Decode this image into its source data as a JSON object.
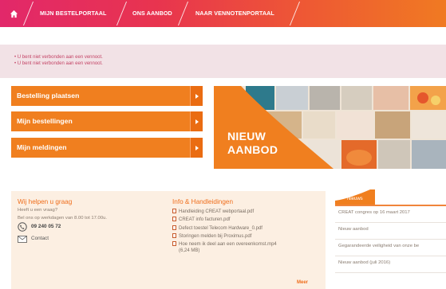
{
  "nav": {
    "items": [
      "MIJN BESTELPORTAAL",
      "ONS AANBOD",
      "NAAR VENNOTENPORTAAL"
    ]
  },
  "messages": [
    "• U bent niet verbonden aan een vennoot.",
    "• U bent niet verbonden aan een vennoot."
  ],
  "menu": [
    {
      "label": "Bestelling plaatsen"
    },
    {
      "label": "Mijn bestellingen"
    },
    {
      "label": "Mijn meldingen"
    }
  ],
  "banner": {
    "line1": "NIEUW",
    "line2": "AANBOD"
  },
  "help": {
    "title": "Wij helpen u graag",
    "question": "Heeft u een vraag?",
    "hours": "Bel ons op werkdagen van 8.00 tot 17.00u.",
    "phone": "09 240 05 72",
    "contact": "Contact"
  },
  "info": {
    "title": "Info & Handleidingen",
    "docs": [
      "Handleiding CREAT webportaal.pdf",
      "CREAT info facturen.pdf",
      "Defect toestel Telecom Hardware_0.pdf",
      "Storingen melden bij Proximus.pdf",
      "Hoe neem ik deel aan een overeenkomst.mp4"
    ],
    "doc_size": "(6,24 MB)",
    "more": "Meer"
  },
  "news": {
    "label": "Nieuws",
    "items": [
      "CREAT congres op 16 maart 2017",
      "Nieuw aanbod",
      "Gegarandeerde veiligheid van onze be",
      "Nieuw aanbod (juli 2016)"
    ]
  },
  "colors": {
    "accent": "#f07f1f",
    "nav_start": "#e2286a",
    "nav_end": "#f07a22",
    "message": "#c44466",
    "panel": "#fcefe2"
  }
}
